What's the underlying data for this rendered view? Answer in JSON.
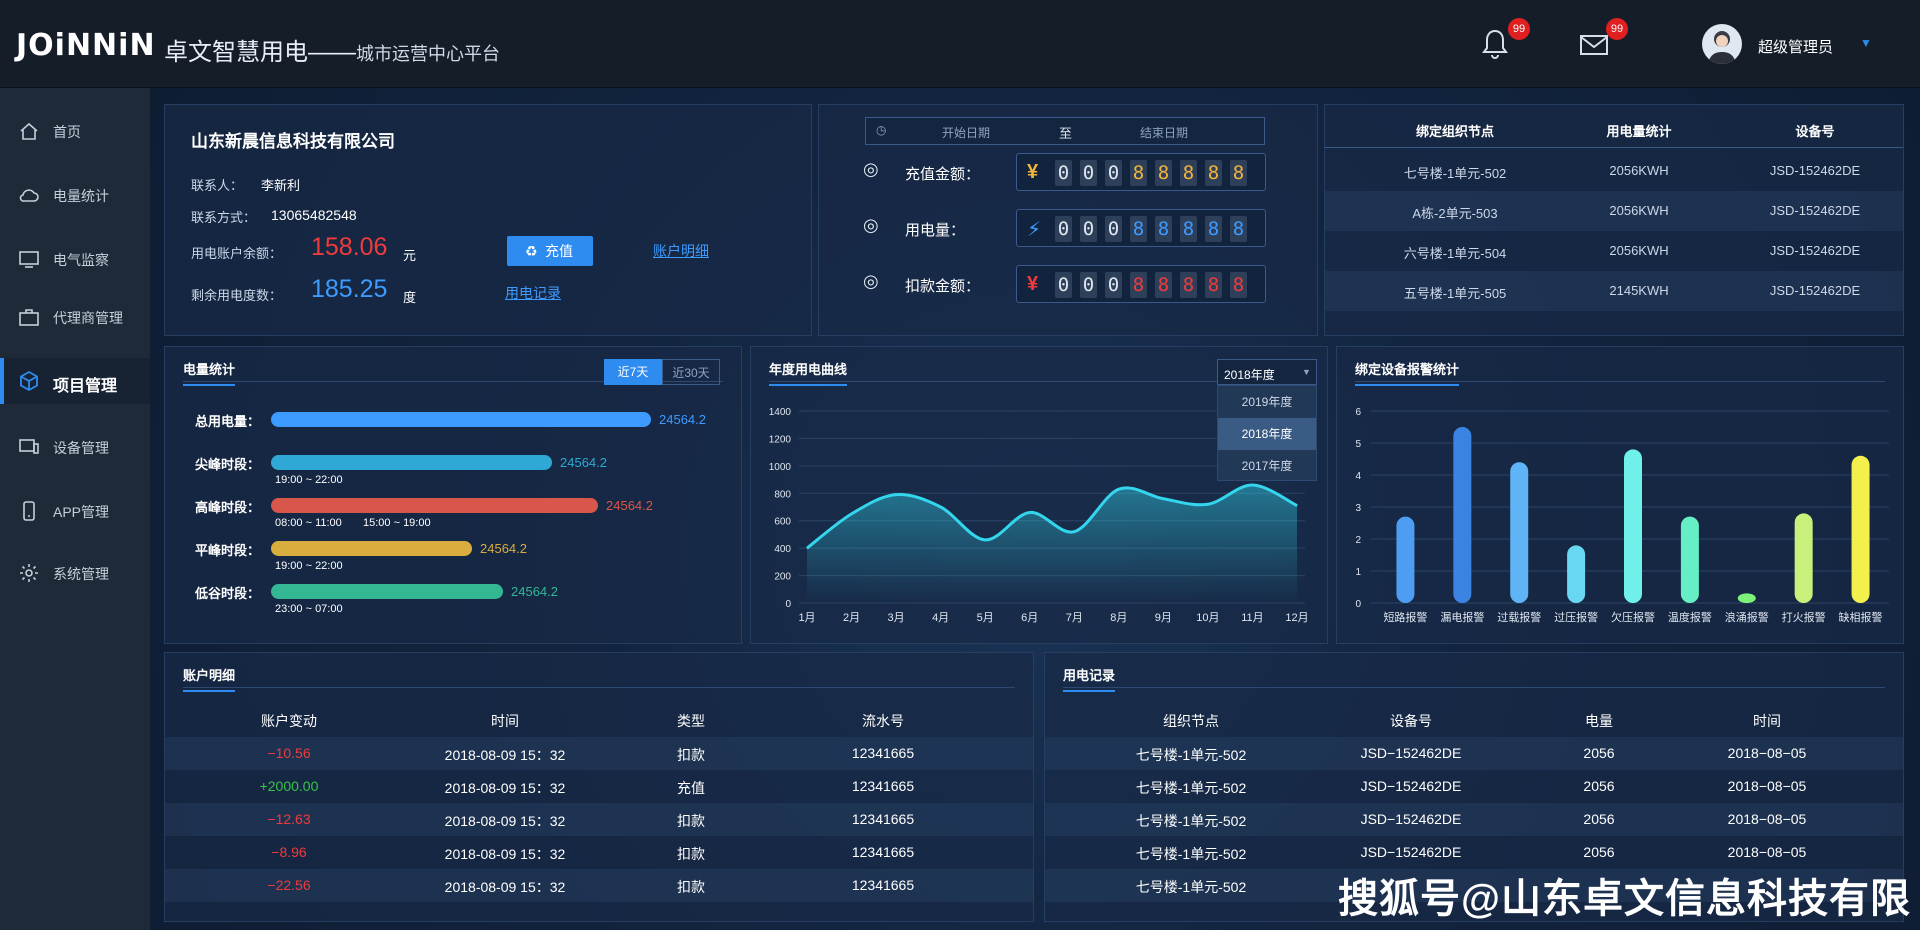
{
  "header": {
    "logo": "JOiNNiN",
    "title": "卓文智慧用电——",
    "subtitle": "城市运营中心平台",
    "bell_count": "99",
    "mail_count": "99",
    "user": "超级管理员"
  },
  "sidebar": {
    "items": [
      "首页",
      "电量统计",
      "电气监察",
      "代理商管理",
      "项目管理",
      "设备管理",
      "APP管理",
      "系统管理"
    ],
    "active": "项目管理"
  },
  "account": {
    "company": "山东新晨信息科技有限公司",
    "contact_label": "联系人：",
    "contact": "李新利",
    "phone_label": "联系方式：",
    "phone": "13065482548",
    "balance_label": "用电账户余额：",
    "balance": "158.06",
    "balance_unit": "元",
    "remain_label": "剩余用电度数：",
    "remain": "185.25",
    "remain_unit": "度",
    "recharge_btn": "充值",
    "detail_link": "账户明细",
    "record_link": "用电记录"
  },
  "counters": {
    "start_placeholder": "开始日期",
    "to": "至",
    "end_placeholder": "结束日期",
    "rows": [
      {
        "label": "充值金额：",
        "symbol": "¥",
        "digits": "00088888",
        "color": "#f2b33a"
      },
      {
        "label": "用电量：",
        "symbol": "⚡",
        "digits": "00088888",
        "color": "#3d9bff"
      },
      {
        "label": "扣款金额：",
        "symbol": "¥",
        "digits": "00088888",
        "color": "#ef3b3b"
      }
    ]
  },
  "binding": {
    "headers": [
      "绑定组织节点",
      "用电量统计",
      "设备号"
    ],
    "rows": [
      [
        "七号楼-1单元-502",
        "2056KWH",
        "JSD-152462DE"
      ],
      [
        "A栋-2单元-503",
        "2056KWH",
        "JSD-152462DE"
      ],
      [
        "六号楼-1单元-504",
        "2056KWH",
        "JSD-152462DE"
      ],
      [
        "五号楼-1单元-505",
        "2145KWH",
        "JSD-152462DE"
      ]
    ]
  },
  "stats": {
    "title": "电量统计",
    "tab7": "近7天",
    "tab30": "近30天",
    "rows": [
      {
        "label": "总用电量：",
        "value": "24564.2",
        "fraction": 1.0,
        "color": "#3d9bff",
        "times": []
      },
      {
        "label": "尖峰时段：",
        "value": "24564.2",
        "fraction": 0.74,
        "color": "#2fa8d6",
        "times": [
          "19:00 ~ 22:00"
        ]
      },
      {
        "label": "高峰时段：",
        "value": "24564.2",
        "fraction": 0.86,
        "color": "#d9574a",
        "times": [
          "08:00 ~ 11:00",
          "15:00 ~ 19:00"
        ]
      },
      {
        "label": "平峰时段：",
        "value": "24564.2",
        "fraction": 0.53,
        "color": "#d9ad3e",
        "times": [
          "19:00 ~ 22:00"
        ]
      },
      {
        "label": "低谷时段：",
        "value": "24564.2",
        "fraction": 0.61,
        "color": "#34b894",
        "times": [
          "23:00 ~ 07:00"
        ]
      }
    ]
  },
  "annual": {
    "title": "年度用电曲线",
    "select": "2018年度",
    "options": [
      "2019年度",
      "2018年度",
      "2017年度"
    ]
  },
  "alarm": {
    "title": "绑定设备报警统计"
  },
  "chart_data": [
    {
      "type": "line",
      "title": "年度用电曲线",
      "x": [
        "1月",
        "2月",
        "3月",
        "4月",
        "5月",
        "6月",
        "7月",
        "8月",
        "9月",
        "10月",
        "11月",
        "12月"
      ],
      "values": [
        400,
        650,
        790,
        700,
        460,
        660,
        520,
        830,
        760,
        720,
        860,
        710
      ],
      "ylim": [
        0,
        1400
      ],
      "yticks": [
        0,
        200,
        400,
        600,
        800,
        1000,
        1200,
        1400
      ],
      "color": "#33d6ec"
    },
    {
      "type": "bar",
      "title": "绑定设备报警统计",
      "categories": [
        "短路报警",
        "漏电报警",
        "过载报警",
        "过压报警",
        "欠压报警",
        "温度报警",
        "浪涌报警",
        "打火报警",
        "缺相报警"
      ],
      "values": [
        2.7,
        5.5,
        4.4,
        1.8,
        4.8,
        2.7,
        0.3,
        2.8,
        4.6
      ],
      "colors": [
        "#4d9ef2",
        "#3b83e0",
        "#5fb4f5",
        "#68d8f2",
        "#6ff0ea",
        "#66eec4",
        "#7cf279",
        "#c9f07a",
        "#f3f04d"
      ],
      "ylim": [
        0,
        6
      ],
      "yticks": [
        0,
        1,
        2,
        3,
        4,
        5,
        6
      ]
    }
  ],
  "ledger": {
    "title": "账户明细",
    "headers": [
      "账户变动",
      "时间",
      "类型",
      "流水号"
    ],
    "rows": [
      [
        "−10.56",
        "2018-08-09  15：32",
        "扣款",
        "12341665"
      ],
      [
        "+2000.00",
        "2018-08-09  15：32",
        "充值",
        "12341665"
      ],
      [
        "−12.63",
        "2018-08-09  15：32",
        "扣款",
        "12341665"
      ],
      [
        "−8.96",
        "2018-08-09  15：32",
        "扣款",
        "12341665"
      ],
      [
        "−22.56",
        "2018-08-09  15：32",
        "扣款",
        "12341665"
      ]
    ]
  },
  "usage": {
    "title": "用电记录",
    "headers": [
      "组织节点",
      "设备号",
      "电量",
      "时间"
    ],
    "rows": [
      [
        "七号楼-1单元-502",
        "JSD−152462DE",
        "2056",
        "2018−08−05"
      ],
      [
        "七号楼-1单元-502",
        "JSD−152462DE",
        "2056",
        "2018−08−05"
      ],
      [
        "七号楼-1单元-502",
        "JSD−152462DE",
        "2056",
        "2018−08−05"
      ],
      [
        "七号楼-1单元-502",
        "JSD−152462DE",
        "2056",
        "2018−08−05"
      ],
      [
        "七号楼-1单元-502",
        "",
        "",
        " "
      ]
    ]
  },
  "watermark": "搜狐号@山东卓文信息科技有限"
}
